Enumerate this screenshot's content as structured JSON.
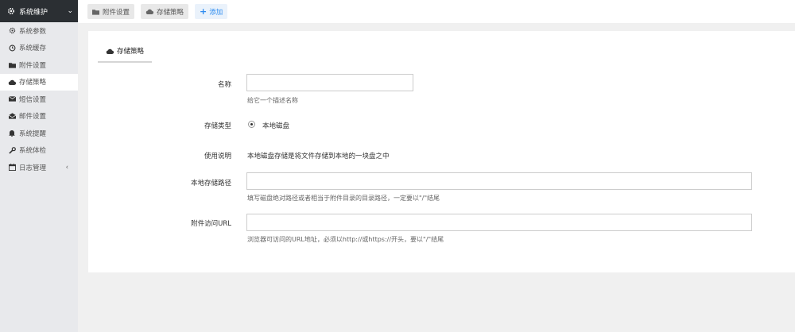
{
  "sidebar": {
    "header": {
      "label": "系统维护",
      "icon": "gear-icon"
    },
    "items": [
      {
        "label": "系统参数",
        "icon": "cog-icon"
      },
      {
        "label": "系统缓存",
        "icon": "clock-icon"
      },
      {
        "label": "附件设置",
        "icon": "folder-icon"
      },
      {
        "label": "存储策略",
        "icon": "cloud-icon"
      },
      {
        "label": "短信设置",
        "icon": "envelope-icon"
      },
      {
        "label": "邮件设置",
        "icon": "envelope-open-icon"
      },
      {
        "label": "系统提醒",
        "icon": "bell-icon"
      },
      {
        "label": "系统体检",
        "icon": "wrench-icon"
      },
      {
        "label": "日志管理",
        "icon": "calendar-icon"
      }
    ]
  },
  "topbar": {
    "tabs": [
      {
        "label": "附件设置",
        "icon": "folder-icon"
      },
      {
        "label": "存储策略",
        "icon": "cloud-icon"
      },
      {
        "label": "添加",
        "icon": "plus-icon"
      }
    ]
  },
  "form": {
    "tab_label": "存储策略",
    "name_label": "名称",
    "name_value": "",
    "name_help": "给它一个描述名称",
    "type_label": "存储类型",
    "type_option": "本地磁盘",
    "usage_label": "使用说明",
    "usage_text": "本地磁盘存储是将文件存储到本地的一块盘之中",
    "path_label": "本地存储路径",
    "path_value": "",
    "path_help": "填写磁盘绝对路径或者相当于附件目录的目录路径，一定要以\"/\"结尾",
    "url_label": "附件访问URL",
    "url_value": "",
    "url_help": "浏览器可访问的URL地址，必须以http://或https://开头，要以\"/\"结尾"
  }
}
